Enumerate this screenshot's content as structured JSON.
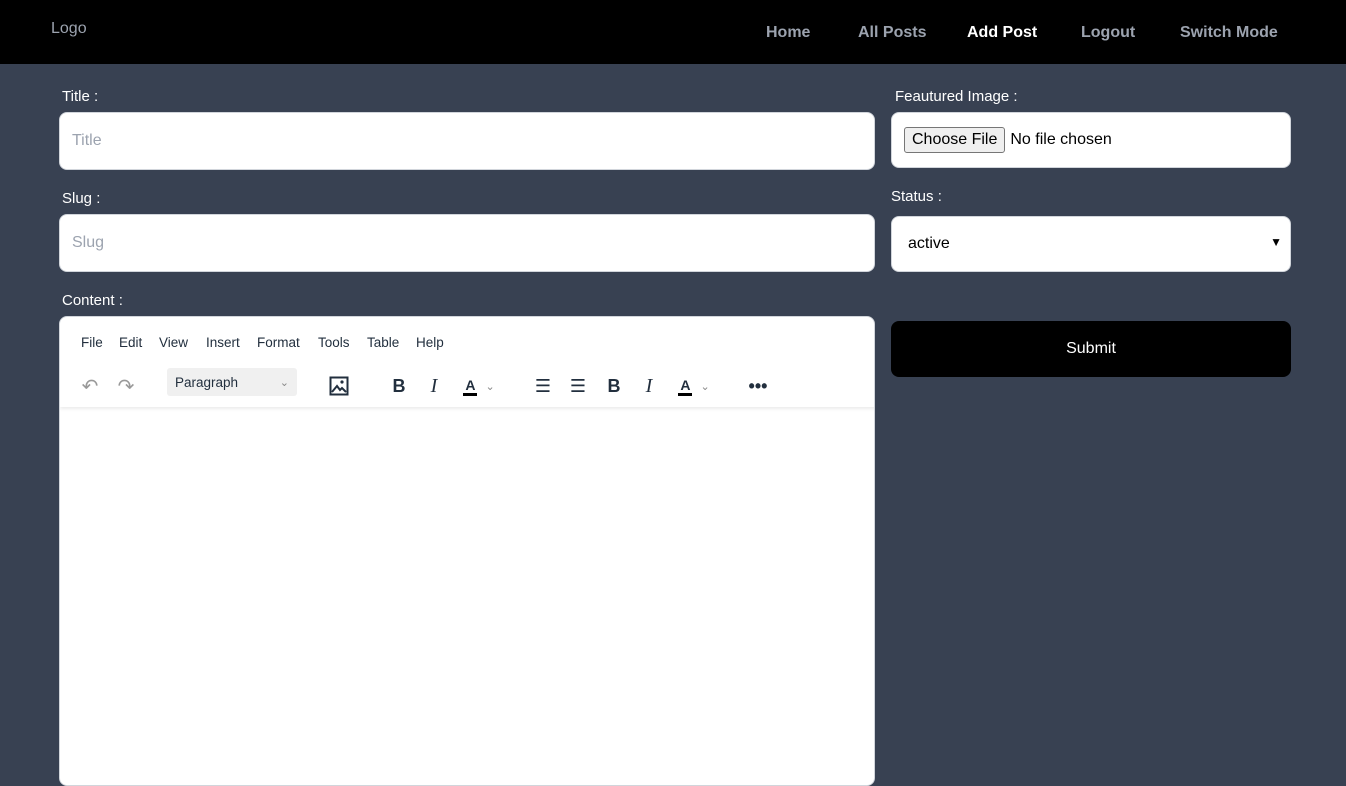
{
  "nav": {
    "logo": "Logo",
    "links": [
      "Home",
      "All Posts",
      "Add Post",
      "Logout",
      "Switch Mode"
    ],
    "active": "Add Post"
  },
  "form": {
    "title_label": "Title :",
    "title_placeholder": "Title",
    "slug_label": "Slug :",
    "slug_placeholder": "Slug",
    "content_label": "Content :",
    "image_label": "Feautured Image :",
    "choose_file": "Choose File",
    "no_file": "No file chosen",
    "status_label": "Status :",
    "status_value": "active",
    "submit": "Submit"
  },
  "editor": {
    "menu": [
      "File",
      "Edit",
      "View",
      "Insert",
      "Format",
      "Tools",
      "Table",
      "Help"
    ],
    "block_format": "Paragraph",
    "toolbar_icons": [
      "undo-icon",
      "redo-icon",
      "image-icon",
      "bold-icon",
      "italic-icon",
      "text-color-icon",
      "align-left-icon",
      "align-center-icon",
      "bold-icon",
      "italic-icon",
      "text-color-icon",
      "more-icon"
    ]
  },
  "colors": {
    "background": "#384152",
    "nav": "#000000",
    "submit": "#000000"
  }
}
